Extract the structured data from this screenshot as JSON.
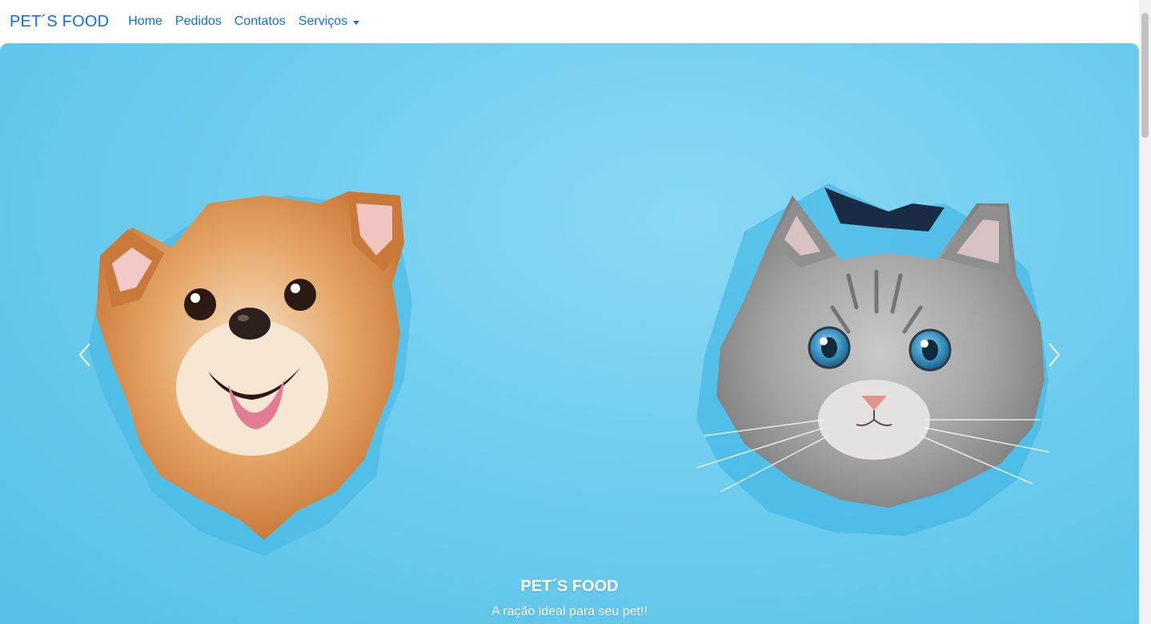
{
  "navbar": {
    "brand": "PET´S FOOD",
    "items": [
      {
        "label": "Home"
      },
      {
        "label": "Pedidos"
      },
      {
        "label": "Contatos"
      },
      {
        "label": "Serviços",
        "dropdown": true
      }
    ],
    "accent_color": "#0d6efd"
  },
  "carousel": {
    "slide": {
      "image": "dog-and-cat-peeking-through-torn-blue-paper",
      "caption_title": "PET´S FOOD",
      "caption_text": "A ração ideal para seu pet!!"
    },
    "controls": {
      "prev_icon": "chevron-left-icon",
      "next_icon": "chevron-right-icon"
    },
    "background_color": "#6fcdee"
  }
}
